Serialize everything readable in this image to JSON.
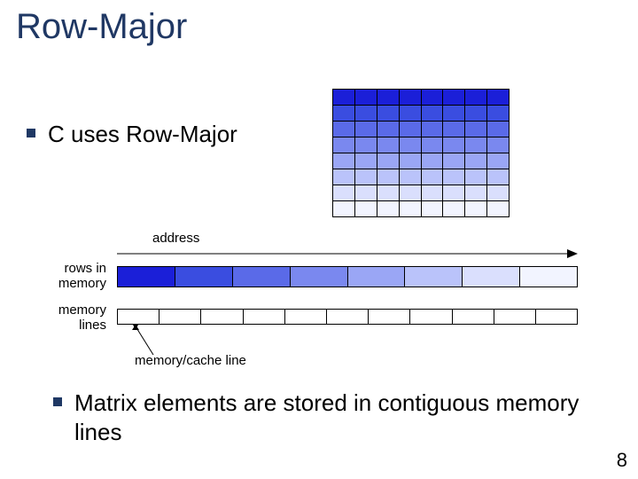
{
  "title": "Row-Major",
  "bullets": {
    "b1": "C uses Row-Major",
    "b2": "Matrix elements are stored in contiguous memory lines"
  },
  "labels": {
    "address": "address",
    "rows_in_memory_1": "rows in",
    "rows_in_memory_2": "memory",
    "memory_lines_1": "memory",
    "memory_lines_2": "lines",
    "cache_line": "memory/cache line"
  },
  "page_number": "8",
  "colors": {
    "row_gradient": [
      "#1b1fd8",
      "#3a4de0",
      "#5a6ae8",
      "#7a88ef",
      "#9aa6f5",
      "#bac3fa",
      "#dadffd",
      "#f2f4ff"
    ]
  },
  "diagram": {
    "matrix": {
      "rows": 8,
      "cols": 8
    },
    "rows_bar_segments": 8,
    "memory_lines_segments": 11
  }
}
